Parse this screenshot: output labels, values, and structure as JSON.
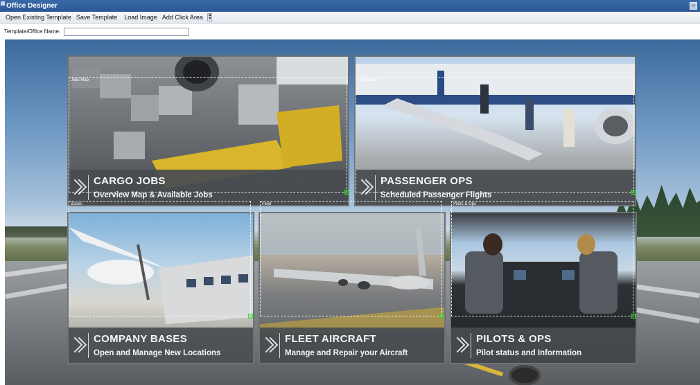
{
  "window": {
    "title": "Office Designer"
  },
  "menu": {
    "items": [
      "Open Existing Template",
      "Save Template",
      "Load Image",
      "Add Click Area"
    ]
  },
  "name_field": {
    "label": "Template/Office Name:",
    "value": ""
  },
  "tiles": [
    {
      "title": "CARGO JOBS",
      "subtitle": "Overview Map & Available Jobs"
    },
    {
      "title": "PASSENGER OPS",
      "subtitle": "Scheduled Passenger Flights"
    },
    {
      "title": "COMPANY BASES",
      "subtitle": "Open and Manage New Locations"
    },
    {
      "title": "FLEET AIRCRAFT",
      "subtitle": "Manage and Repair your Aircraft"
    },
    {
      "title": "PILOTS & OPS",
      "subtitle": "Pilot status and Information"
    }
  ],
  "click_areas": [
    {
      "label": "Jobs Map"
    },
    {
      "label": "Pax Route"
    },
    {
      "label": "Bases"
    },
    {
      "label": "Fleet"
    },
    {
      "label": "Pilots & Ops"
    }
  ],
  "colors": {
    "titlebar": "#2b5896",
    "tile_band": "#484c50",
    "click_handle": "#29e829"
  }
}
